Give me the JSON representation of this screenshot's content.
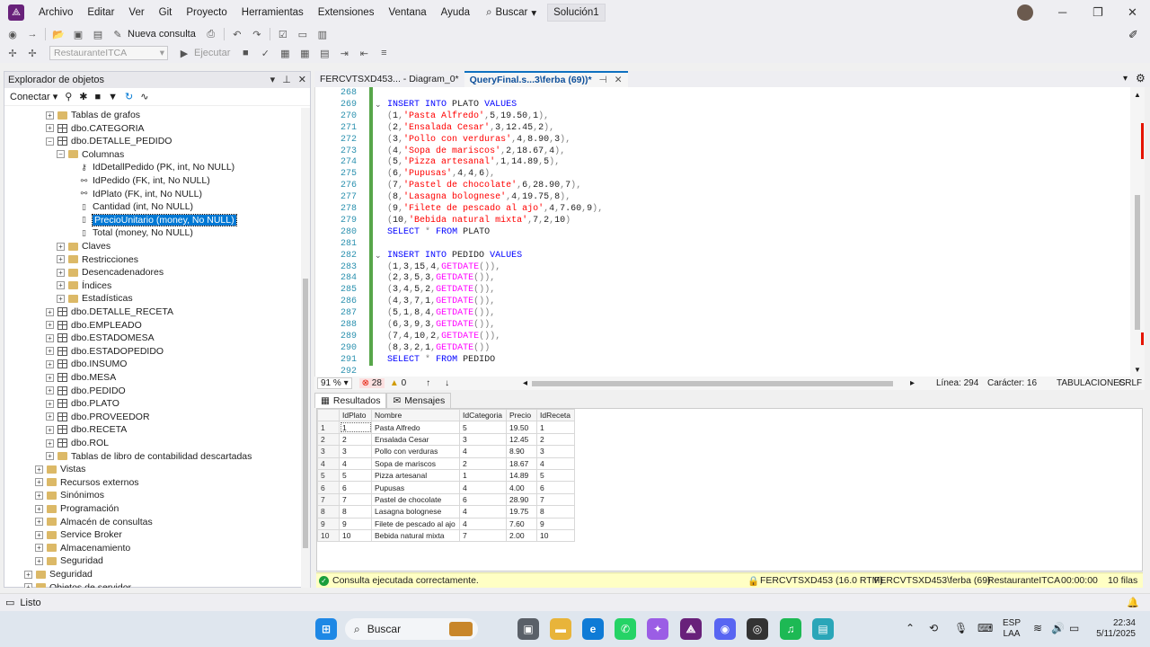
{
  "menu": {
    "items": [
      "Archivo",
      "Editar",
      "Ver",
      "Git",
      "Proyecto",
      "Herramientas",
      "Extensiones",
      "Ventana",
      "Ayuda"
    ],
    "search_label": "Buscar",
    "solution": "Solución1"
  },
  "toolbar": {
    "new_query": "Nueva consulta",
    "database": "RestauranteITCA",
    "execute": "Ejecutar"
  },
  "object_explorer": {
    "title": "Explorador de objetos",
    "connect": "Conectar",
    "tree": [
      {
        "label": "Tablas de grafos",
        "kind": "folder",
        "indent": 1,
        "exp": "+"
      },
      {
        "label": "dbo.CATEGORIA",
        "kind": "table",
        "indent": 1,
        "exp": "+"
      },
      {
        "label": "dbo.DETALLE_PEDIDO",
        "kind": "table",
        "indent": 1,
        "exp": "-"
      },
      {
        "label": "Columnas",
        "kind": "folder",
        "indent": 2,
        "exp": "-"
      },
      {
        "label": "IdDetallPedido (PK, int, No NULL)",
        "kind": "pk",
        "indent": 3,
        "exp": ""
      },
      {
        "label": "IdPedido (FK, int, No NULL)",
        "kind": "fk",
        "indent": 3,
        "exp": ""
      },
      {
        "label": "IdPlato (FK, int, No NULL)",
        "kind": "fk",
        "indent": 3,
        "exp": ""
      },
      {
        "label": "Cantidad (int, No NULL)",
        "kind": "col",
        "indent": 3,
        "exp": ""
      },
      {
        "label": "PrecioUnitario (money, No NULL)",
        "kind": "col",
        "indent": 3,
        "exp": "",
        "selected": true
      },
      {
        "label": "Total (money, No NULL)",
        "kind": "col",
        "indent": 3,
        "exp": ""
      },
      {
        "label": "Claves",
        "kind": "folder",
        "indent": 2,
        "exp": "+"
      },
      {
        "label": "Restricciones",
        "kind": "folder",
        "indent": 2,
        "exp": "+"
      },
      {
        "label": "Desencadenadores",
        "kind": "folder",
        "indent": 2,
        "exp": "+"
      },
      {
        "label": "Índices",
        "kind": "folder",
        "indent": 2,
        "exp": "+"
      },
      {
        "label": "Estadísticas",
        "kind": "folder",
        "indent": 2,
        "exp": "+"
      },
      {
        "label": "dbo.DETALLE_RECETA",
        "kind": "table",
        "indent": 1,
        "exp": "+"
      },
      {
        "label": "dbo.EMPLEADO",
        "kind": "table",
        "indent": 1,
        "exp": "+"
      },
      {
        "label": "dbo.ESTADOMESA",
        "kind": "table",
        "indent": 1,
        "exp": "+"
      },
      {
        "label": "dbo.ESTADOPEDIDO",
        "kind": "table",
        "indent": 1,
        "exp": "+"
      },
      {
        "label": "dbo.INSUMO",
        "kind": "table",
        "indent": 1,
        "exp": "+"
      },
      {
        "label": "dbo.MESA",
        "kind": "table",
        "indent": 1,
        "exp": "+"
      },
      {
        "label": "dbo.PEDIDO",
        "kind": "table",
        "indent": 1,
        "exp": "+"
      },
      {
        "label": "dbo.PLATO",
        "kind": "table",
        "indent": 1,
        "exp": "+"
      },
      {
        "label": "dbo.PROVEEDOR",
        "kind": "table",
        "indent": 1,
        "exp": "+"
      },
      {
        "label": "dbo.RECETA",
        "kind": "table",
        "indent": 1,
        "exp": "+"
      },
      {
        "label": "dbo.ROL",
        "kind": "table",
        "indent": 1,
        "exp": "+"
      },
      {
        "label": "Tablas de libro de contabilidad descartadas",
        "kind": "folder",
        "indent": 1,
        "exp": "+"
      },
      {
        "label": "Vistas",
        "kind": "folder",
        "indent": 0,
        "exp": "+"
      },
      {
        "label": "Recursos externos",
        "kind": "folder",
        "indent": 0,
        "exp": "+"
      },
      {
        "label": "Sinónimos",
        "kind": "folder",
        "indent": 0,
        "exp": "+"
      },
      {
        "label": "Programación",
        "kind": "folder",
        "indent": 0,
        "exp": "+"
      },
      {
        "label": "Almacén de consultas",
        "kind": "folder",
        "indent": 0,
        "exp": "+"
      },
      {
        "label": "Service Broker",
        "kind": "folder",
        "indent": 0,
        "exp": "+"
      },
      {
        "label": "Almacenamiento",
        "kind": "folder",
        "indent": 0,
        "exp": "+"
      },
      {
        "label": "Seguridad",
        "kind": "folder",
        "indent": 0,
        "exp": "+"
      },
      {
        "label": "Seguridad",
        "kind": "folder",
        "indent": -1,
        "exp": "+"
      },
      {
        "label": "Objetos de servidor",
        "kind": "folder",
        "indent": -1,
        "exp": "+"
      }
    ]
  },
  "tabs": [
    {
      "label": "FERCVTSXD453... - Diagram_0*",
      "active": false
    },
    {
      "label": "QueryFinal.s...3\\ferba (69))*",
      "active": true
    }
  ],
  "editor": {
    "line_numbers": [
      "268",
      "269",
      "270",
      "271",
      "272",
      "273",
      "274",
      "275",
      "276",
      "277",
      "278",
      "279",
      "280",
      "281",
      "282",
      "283",
      "284",
      "285",
      "286",
      "287",
      "288",
      "289",
      "290",
      "291",
      "292"
    ],
    "lines": [
      "",
      "INSERT INTO PLATO VALUES",
      "(1,'Pasta Alfredo',5,19.50,1),",
      "(2,'Ensalada Cesar',3,12.45,2),",
      "(3,'Pollo con verduras',4,8.90,3),",
      "(4,'Sopa de mariscos',2,18.67,4),",
      "(5,'Pizza artesanal',1,14.89,5),",
      "(6,'Pupusas',4,4,6),",
      "(7,'Pastel de chocolate',6,28.90,7),",
      "(8,'Lasagna bolognese',4,19.75,8),",
      "(9,'Filete de pescado al ajo',4,7.60,9),",
      "(10,'Bebida natural mixta',7,2,10)",
      "SELECT * FROM PLATO",
      "",
      "INSERT INTO PEDIDO VALUES",
      "(1,3,15,4,GETDATE()),",
      "(2,3,5,3,GETDATE()),",
      "(3,4,5,2,GETDATE()),",
      "(4,3,7,1,GETDATE()),",
      "(5,1,8,4,GETDATE()),",
      "(6,3,9,3,GETDATE()),",
      "(7,4,10,2,GETDATE()),",
      "(8,3,2,1,GETDATE())",
      "SELECT * FROM PEDIDO",
      ""
    ]
  },
  "editor_status": {
    "zoom": "91 %",
    "errors": "28",
    "warnings": "0",
    "line": "Línea: 294",
    "char": "Carácter: 16",
    "tabs": "TABULACIONES",
    "eol": "CRLF"
  },
  "results": {
    "tab_results": "Resultados",
    "tab_messages": "Mensajes",
    "columns": [
      "IdPlato",
      "Nombre",
      "IdCategoria",
      "Precio",
      "IdReceta"
    ],
    "rows": [
      [
        "1",
        "1",
        "Pasta Alfredo",
        "5",
        "19.50",
        "1"
      ],
      [
        "2",
        "2",
        "Ensalada Cesar",
        "3",
        "12.45",
        "2"
      ],
      [
        "3",
        "3",
        "Pollo con verduras",
        "4",
        "8.90",
        "3"
      ],
      [
        "4",
        "4",
        "Sopa de mariscos",
        "2",
        "18.67",
        "4"
      ],
      [
        "5",
        "5",
        "Pizza artesanal",
        "1",
        "14.89",
        "5"
      ],
      [
        "6",
        "6",
        "Pupusas",
        "4",
        "4.00",
        "6"
      ],
      [
        "7",
        "7",
        "Pastel de chocolate",
        "6",
        "28.90",
        "7"
      ],
      [
        "8",
        "8",
        "Lasagna bolognese",
        "4",
        "19.75",
        "8"
      ],
      [
        "9",
        "9",
        "Filete de pescado al ajo",
        "4",
        "7.60",
        "9"
      ],
      [
        "10",
        "10",
        "Bebida natural mixta",
        "7",
        "2.00",
        "10"
      ]
    ]
  },
  "query_status": {
    "message": "Consulta ejecutada correctamente.",
    "server": "FERCVTSXD453 (16.0 RTM)",
    "user": "FERCVTSXD453\\ferba (69)",
    "database": "RestauranteITCA",
    "time": "00:00:00",
    "rows": "10 filas"
  },
  "app_status": "Listo",
  "taskbar": {
    "search": "Buscar",
    "lang1": "ESP",
    "lang2": "LAA",
    "time": "22:34",
    "date": "5/11/2025"
  },
  "colors": {
    "accent": "#0078d4",
    "status_yellow": "#ffffc4",
    "change_bar": "#57a64a"
  }
}
